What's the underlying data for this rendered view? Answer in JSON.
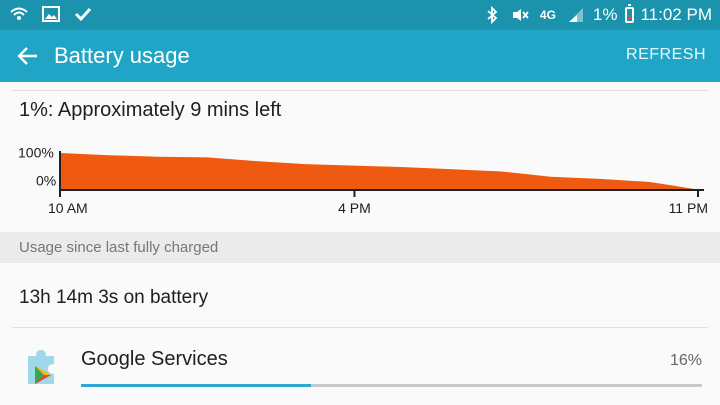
{
  "status_bar": {
    "network_badge": "4G",
    "battery_percent": "1%",
    "time": "11:02 PM",
    "left_icons": [
      "wifi-call-icon",
      "image-icon",
      "check-icon"
    ],
    "right_icons": [
      "bluetooth-icon",
      "mute-icon",
      "signal-icon",
      "battery-low-icon"
    ]
  },
  "app_bar": {
    "title": "Battery usage",
    "refresh_label": "REFRESH"
  },
  "battery": {
    "estimate_text": "1%: Approximately 9 mins left",
    "accent_color": "#ef5a10"
  },
  "chart_data": {
    "type": "area",
    "y_tick_labels": [
      "100%",
      "0%"
    ],
    "ylim": [
      0,
      100
    ],
    "x_tick_labels": [
      "10 AM",
      "4 PM",
      "11 PM"
    ],
    "x_hours": [
      10,
      23
    ],
    "x_tick_hours": [
      10,
      16,
      23
    ],
    "series": [
      {
        "x": [
          10,
          11,
          12,
          13,
          14,
          15,
          16,
          17,
          18,
          19,
          20,
          21,
          22,
          22.5,
          23
        ],
        "y": [
          100,
          94,
          90,
          88,
          78,
          70,
          66,
          62,
          56,
          50,
          36,
          30,
          22,
          12,
          1
        ]
      }
    ]
  },
  "section_header": "Usage since last fully charged",
  "on_battery": "13h 14m 3s on battery",
  "apps": [
    {
      "name": "Google Services",
      "percent_label": "16%",
      "usage_fraction": 0.37
    }
  ]
}
